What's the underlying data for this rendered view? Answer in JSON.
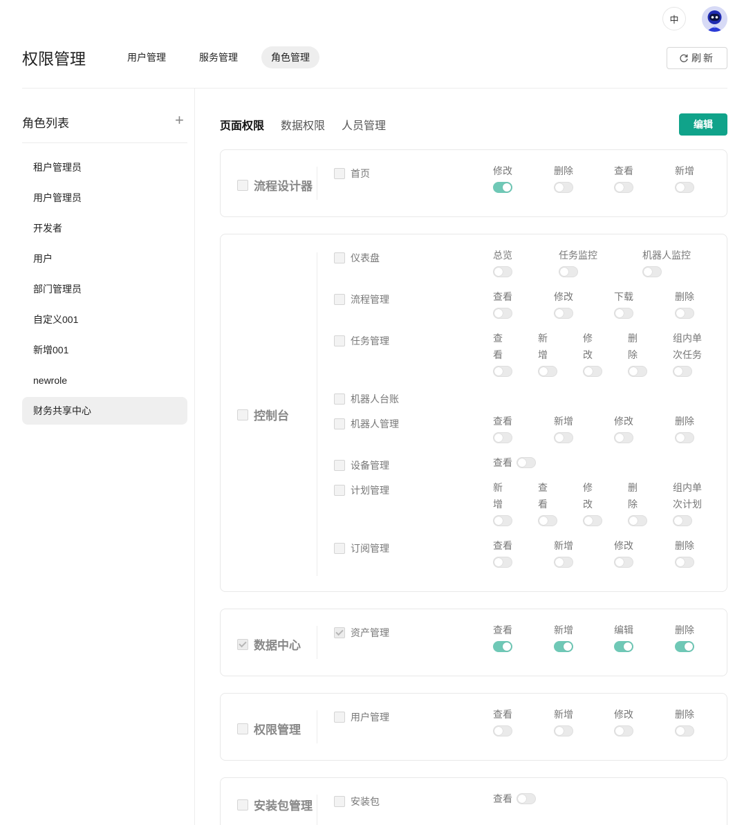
{
  "header": {
    "lang_label": "中",
    "page_title": "权限管理",
    "tabs": [
      {
        "label": "用户管理",
        "active": false
      },
      {
        "label": "服务管理",
        "active": false
      },
      {
        "label": "角色管理",
        "active": true
      }
    ],
    "refresh_label": "刷新"
  },
  "sidebar": {
    "title": "角色列表",
    "add_label": "+",
    "roles": [
      {
        "label": "租户管理员",
        "active": false
      },
      {
        "label": "用户管理员",
        "active": false
      },
      {
        "label": "开发者",
        "active": false
      },
      {
        "label": "用户",
        "active": false
      },
      {
        "label": "部门管理员",
        "active": false
      },
      {
        "label": "自定义001",
        "active": false
      },
      {
        "label": "新增001",
        "active": false
      },
      {
        "label": "newrole",
        "active": false
      },
      {
        "label": "财务共享中心",
        "active": true
      }
    ]
  },
  "permission_tabs": [
    {
      "label": "页面权限",
      "active": true
    },
    {
      "label": "数据权限",
      "active": false
    },
    {
      "label": "人员管理",
      "active": false
    }
  ],
  "edit_label": "编辑",
  "colors": {
    "accent": "#10a38a",
    "toggle_on": "#6fc8b6"
  },
  "modules": [
    {
      "name": "流程设计器",
      "checked": false,
      "pages": [
        {
          "label": "首页",
          "checked": false,
          "perms": [
            {
              "label": "修改",
              "on": true
            },
            {
              "label": "删除",
              "on": false
            },
            {
              "label": "查看",
              "on": false
            },
            {
              "label": "新增",
              "on": false
            }
          ]
        }
      ]
    },
    {
      "name": "控制台",
      "checked": false,
      "pages": [
        {
          "label": "仪表盘",
          "checked": false,
          "perms": [
            {
              "label": "总览",
              "on": false
            },
            {
              "label": "任务监控",
              "on": false
            },
            {
              "label": "机器人监控",
              "on": false
            }
          ]
        },
        {
          "label": "流程管理",
          "checked": false,
          "perms": [
            {
              "label": "查看",
              "on": false
            },
            {
              "label": "修改",
              "on": false
            },
            {
              "label": "下载",
              "on": false
            },
            {
              "label": "删除",
              "on": false
            }
          ]
        },
        {
          "label": "任务管理",
          "checked": false,
          "perms": [
            {
              "label": "查\n看",
              "on": false
            },
            {
              "label": "新\n增",
              "on": false
            },
            {
              "label": "修\n改",
              "on": false
            },
            {
              "label": "删\n除",
              "on": false
            },
            {
              "label": "组内单\n次任务",
              "on": false
            }
          ]
        },
        {
          "label": "机器人台账",
          "checked": false,
          "perms": []
        },
        {
          "label": "机器人管理",
          "checked": false,
          "perms": [
            {
              "label": "查看",
              "on": false
            },
            {
              "label": "新增",
              "on": false
            },
            {
              "label": "修改",
              "on": false
            },
            {
              "label": "删除",
              "on": false
            }
          ]
        },
        {
          "label": "设备管理",
          "checked": false,
          "perms": [
            {
              "label": "查看",
              "on": false
            }
          ]
        },
        {
          "label": "计划管理",
          "checked": false,
          "perms": [
            {
              "label": "新\n增",
              "on": false
            },
            {
              "label": "查\n看",
              "on": false
            },
            {
              "label": "修\n改",
              "on": false
            },
            {
              "label": "删\n除",
              "on": false
            },
            {
              "label": "组内单\n次计划",
              "on": false
            }
          ]
        },
        {
          "label": "订阅管理",
          "checked": false,
          "perms": [
            {
              "label": "查看",
              "on": false
            },
            {
              "label": "新增",
              "on": false
            },
            {
              "label": "修改",
              "on": false
            },
            {
              "label": "删除",
              "on": false
            }
          ]
        }
      ]
    },
    {
      "name": "数据中心",
      "checked": true,
      "pages": [
        {
          "label": "资产管理",
          "checked": true,
          "perms": [
            {
              "label": "查看",
              "on": true
            },
            {
              "label": "新增",
              "on": true
            },
            {
              "label": "编辑",
              "on": true
            },
            {
              "label": "删除",
              "on": true
            }
          ]
        }
      ]
    },
    {
      "name": "权限管理",
      "checked": false,
      "pages": [
        {
          "label": "用户管理",
          "checked": false,
          "perms": [
            {
              "label": "查看",
              "on": false
            },
            {
              "label": "新增",
              "on": false
            },
            {
              "label": "修改",
              "on": false
            },
            {
              "label": "删除",
              "on": false
            }
          ]
        }
      ]
    },
    {
      "name": "安装包管理",
      "checked": false,
      "pages": [
        {
          "label": "安装包",
          "checked": false,
          "perms": [
            {
              "label": "查看",
              "on": false
            }
          ]
        }
      ]
    }
  ]
}
